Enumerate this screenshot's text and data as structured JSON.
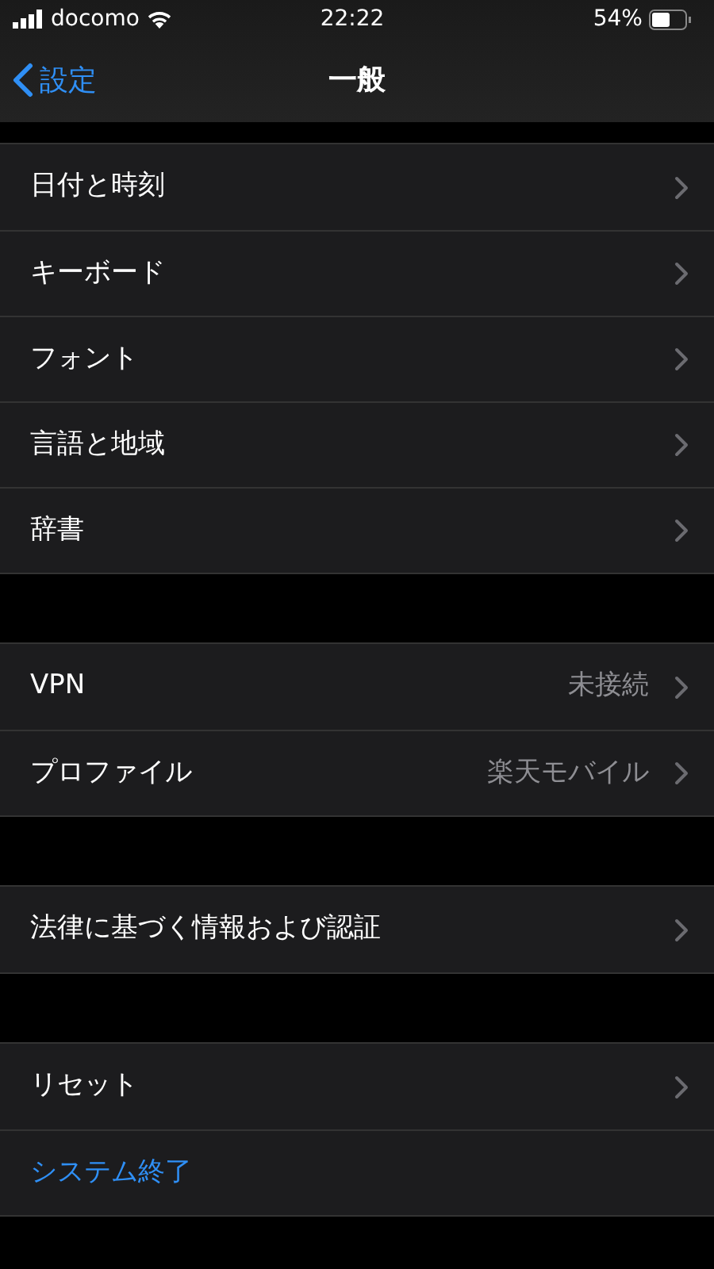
{
  "status_bar": {
    "carrier": "docomo",
    "time": "22:22",
    "battery": "54%"
  },
  "nav": {
    "back": "設定",
    "title": "一般"
  },
  "groups": [
    {
      "rows": [
        {
          "label": "日付と時刻",
          "kind": "nav"
        },
        {
          "label": "キーボード",
          "kind": "nav"
        },
        {
          "label": "フォント",
          "kind": "nav"
        },
        {
          "label": "言語と地域",
          "kind": "nav"
        },
        {
          "label": "辞書",
          "kind": "nav"
        }
      ]
    },
    {
      "rows": [
        {
          "label": "VPN",
          "value": "未接続",
          "kind": "nav"
        },
        {
          "label": "プロファイル",
          "value": "楽天モバイル",
          "kind": "nav"
        }
      ]
    },
    {
      "rows": [
        {
          "label": "法律に基づく情報および認証",
          "kind": "nav"
        }
      ]
    },
    {
      "rows": [
        {
          "label": "リセット",
          "kind": "nav"
        },
        {
          "label": "システム終了",
          "kind": "action"
        }
      ]
    }
  ]
}
